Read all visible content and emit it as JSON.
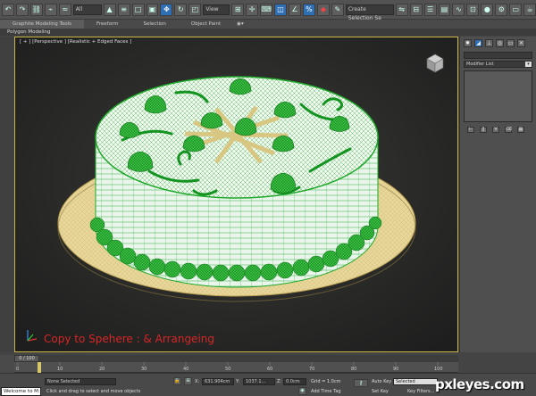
{
  "toolbar": {
    "selection_filter": "All",
    "view_dropdown": "View",
    "named_selection_placeholder": "Create Selection Se"
  },
  "ribbon": {
    "tabs": [
      "Graphite Modeling Tools",
      "Freeform",
      "Selection",
      "Object Paint"
    ],
    "sub_panel": "Polygon Modeling"
  },
  "viewport": {
    "label": "[ + ] [Perspective ] [Realistic + Edged Faces ]",
    "overlay_text": "Copy to Spehere : & Arrangeing"
  },
  "command_panel": {
    "modifier_list": "Modifier List"
  },
  "timeline": {
    "slider": "0 / 100",
    "ticks": [
      "0",
      "10",
      "20",
      "30",
      "40",
      "50",
      "60",
      "70",
      "80",
      "90",
      "100"
    ]
  },
  "status": {
    "selection_status": "None Selected",
    "prompt": "Click and drag to select and move objects",
    "x_label": "X:",
    "x_value": "631.904cm",
    "y_label": "Y:",
    "y_value": "1037.1...",
    "z_label": "Z:",
    "z_value": "0.0cm",
    "grid": "Grid = 1.0cm",
    "add_time_tag": "Add Time Tag",
    "auto_key": "Auto Key",
    "set_key": "Set Key",
    "key_mode": "Selected",
    "key_filters": "Key Filters...",
    "welcome": "Welcome to M:"
  },
  "watermark": "pxleyes.com",
  "colors": {
    "wire_green": "#1fa82a",
    "plate_cream": "#e8d79a",
    "highlight_blue": "#2f6fb3",
    "viewport_border": "#c9b443",
    "overlay_red": "#d62626"
  }
}
